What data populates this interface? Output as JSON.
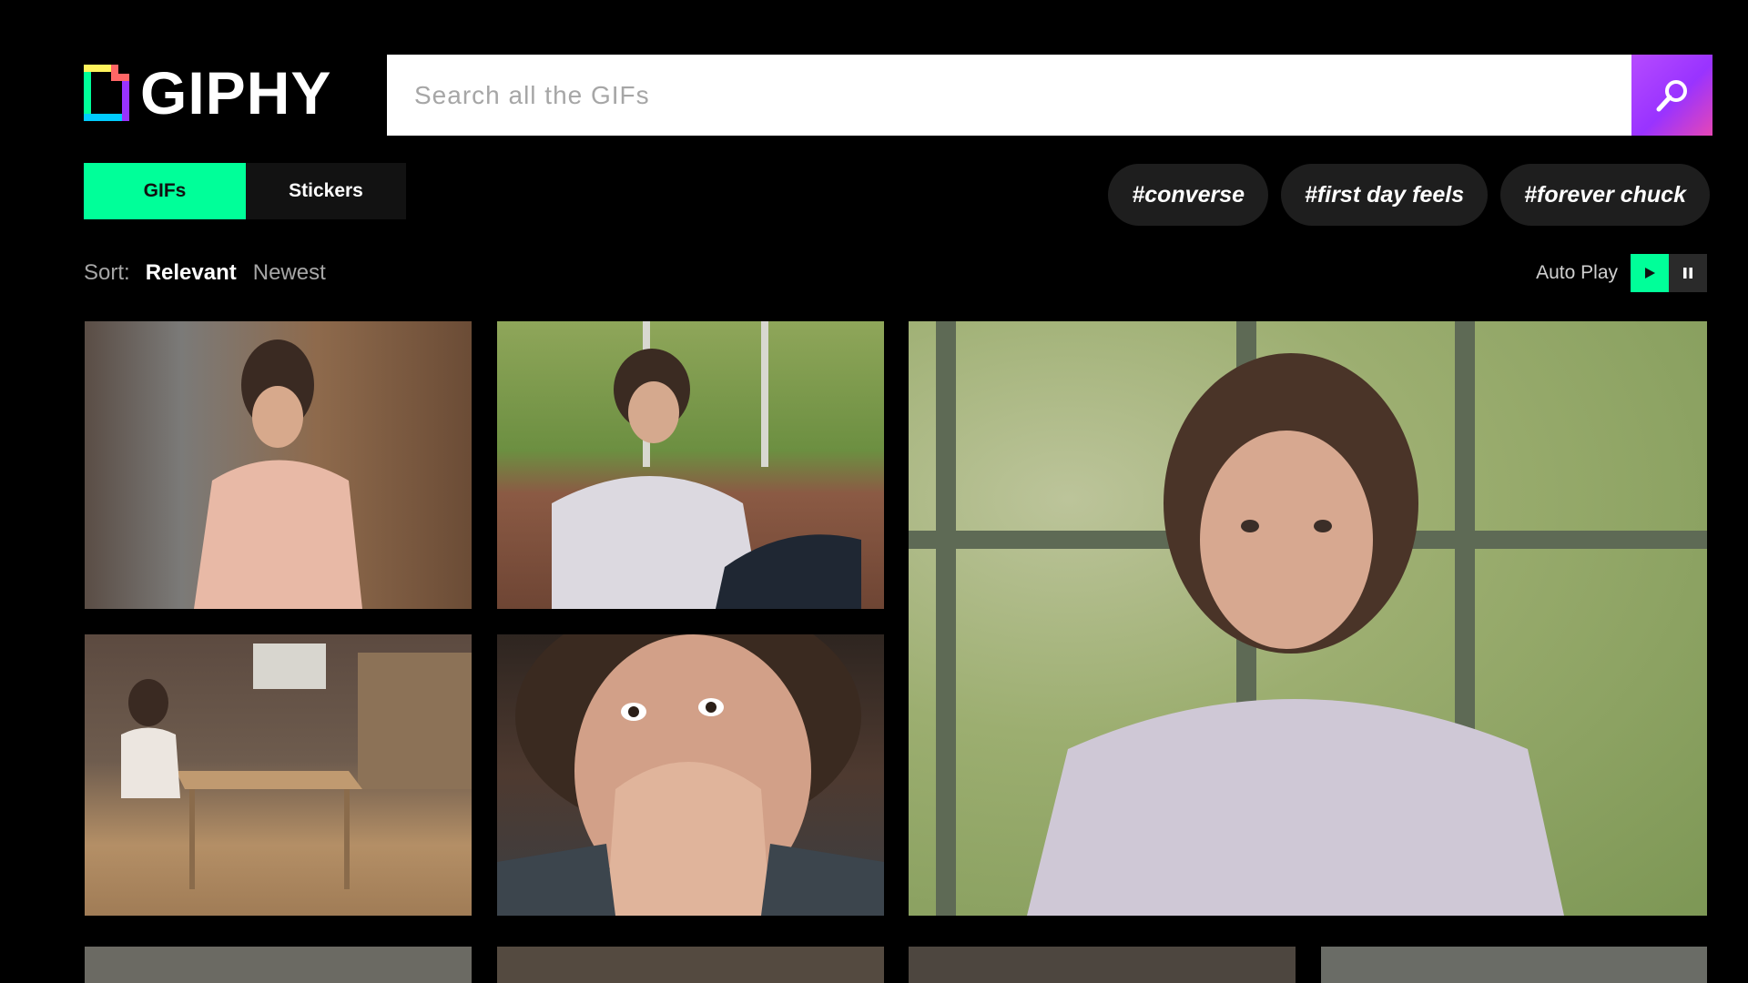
{
  "header": {
    "logo_text": "GIPHY",
    "search_placeholder": "Search all the GIFs",
    "search_icon": "search-icon"
  },
  "tabs": [
    {
      "label": "GIFs",
      "active": true
    },
    {
      "label": "Stickers",
      "active": false
    }
  ],
  "hashtags": [
    "#converse",
    "#first day feels",
    "#forever chuck"
  ],
  "sort": {
    "label": "Sort:",
    "options": [
      {
        "label": "Relevant",
        "active": true
      },
      {
        "label": "Newest",
        "active": false
      }
    ]
  },
  "autoplay": {
    "label": "Auto Play",
    "play_icon": "play-icon",
    "pause_icon": "pause-icon",
    "state": "playing"
  },
  "colors": {
    "accent_green": "#00ff99",
    "accent_purple": "#9933ff",
    "background": "#000000"
  },
  "gifs": [
    "gif-tile-1",
    "gif-tile-2",
    "gif-tile-3",
    "gif-tile-4",
    "gif-tile-5",
    "gif-tile-6",
    "gif-tile-7",
    "gif-tile-8",
    "gif-tile-9"
  ]
}
